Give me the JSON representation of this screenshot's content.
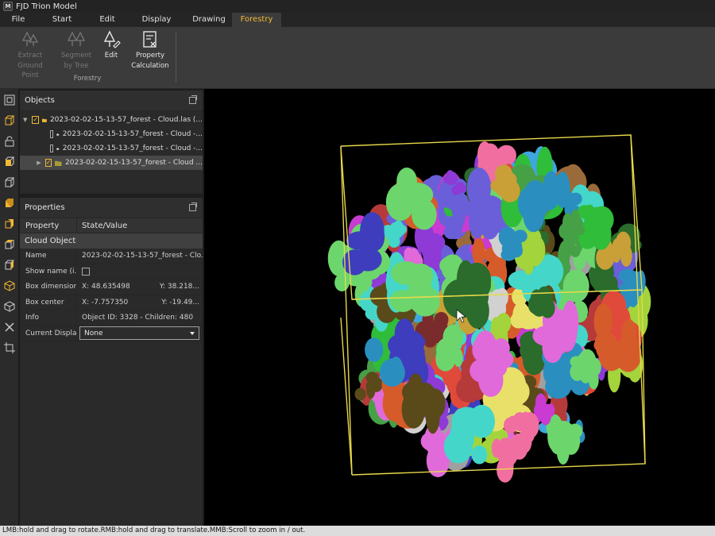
{
  "window": {
    "title": "FJD Trion Model",
    "logo_text": "M"
  },
  "menu": {
    "tabs": [
      {
        "label": "File"
      },
      {
        "label": "Start"
      },
      {
        "label": "Edit"
      },
      {
        "label": "Display"
      },
      {
        "label": "Drawing"
      },
      {
        "label": "Forestry"
      }
    ],
    "active": "Forestry",
    "accent_color": "#f0b833"
  },
  "ribbon": {
    "buttons": [
      {
        "label_line1": "Extract Ground",
        "label_line2": "Point",
        "icon": "trees-icon",
        "enabled": false
      },
      {
        "label_line1": "Segment",
        "label_line2": "by Tree",
        "icon": "trees-icon",
        "enabled": false
      },
      {
        "label_line1": "Edit",
        "label_line2": "",
        "icon": "tree-edit-icon",
        "enabled": true
      },
      {
        "label_line1": "Property",
        "label_line2": "Calculation",
        "icon": "calculation-icon",
        "enabled": true
      }
    ],
    "group_label": "Forestry"
  },
  "objects_panel": {
    "title": "Objects",
    "items": [
      {
        "label": "2023-02-02-15-13-57_forest - Cloud.las (...",
        "checked": true,
        "expanded": true,
        "icon": "folder-icon"
      },
      {
        "label": "2023-02-02-15-13-57_forest - Cloud -...",
        "checked": false,
        "icon": "cloud-icon"
      },
      {
        "label": "2023-02-02-15-13-57_forest - Cloud -...",
        "checked": false,
        "icon": "cloud-icon"
      },
      {
        "label": "2023-02-02-15-13-57_forest - Cloud ...",
        "checked": true,
        "expanded": false,
        "icon": "tree-group-icon"
      }
    ]
  },
  "properties_panel": {
    "title": "Properties",
    "col_property": "Property",
    "col_value": "State/Value",
    "section": "Cloud Object",
    "rows": {
      "name_label": "Name",
      "name_value": "2023-02-02-15-13-57_forest - Clo...",
      "show_name_label": "Show name (i...",
      "box_dim_label": "Box dimensions",
      "box_dim_x": "X: 48.635498",
      "box_dim_y": "Y: 38.218...",
      "box_center_label": "Box center",
      "box_center_x": "X: -7.757350",
      "box_center_y": "Y: -19.49...",
      "info_label": "Info",
      "info_value": "Object ID: 3328 - Children: 480",
      "display_label": "Current Display",
      "display_value": "None"
    }
  },
  "left_toolbar": {
    "icons": [
      "select-icon",
      "cube-wire-icon",
      "lock-icon",
      "cube-icon",
      "cube-outline-icon",
      "cube-orange-icon",
      "cube-orange2-icon",
      "cube-side-icon",
      "cube-side2-icon",
      "box-icon",
      "box2-icon",
      "tools-icon",
      "crop-icon"
    ]
  },
  "viewport": {
    "bbox_color": "#e6d94a",
    "tree_colors": [
      "#c93bd1",
      "#6a5fd8",
      "#3fa6e0",
      "#e04a3a",
      "#2fbd3a",
      "#c9a037",
      "#a3d43b",
      "#e06ad9",
      "#5a4a1a",
      "#2a8fbf",
      "#d1d1d1",
      "#7a2b2b",
      "#f06fa0",
      "#44d6c9",
      "#9a6a3a",
      "#b63a3a",
      "#3d3dbd",
      "#a0a0a0",
      "#e9e06a",
      "#46a046",
      "#8d3ad6",
      "#d65b2a",
      "#6cd66c",
      "#2b6b2b"
    ]
  },
  "status": {
    "text": "LMB:hold and drag to rotate.RMB:hold and drag to translate.MMB:Scroll to zoom in / out."
  }
}
